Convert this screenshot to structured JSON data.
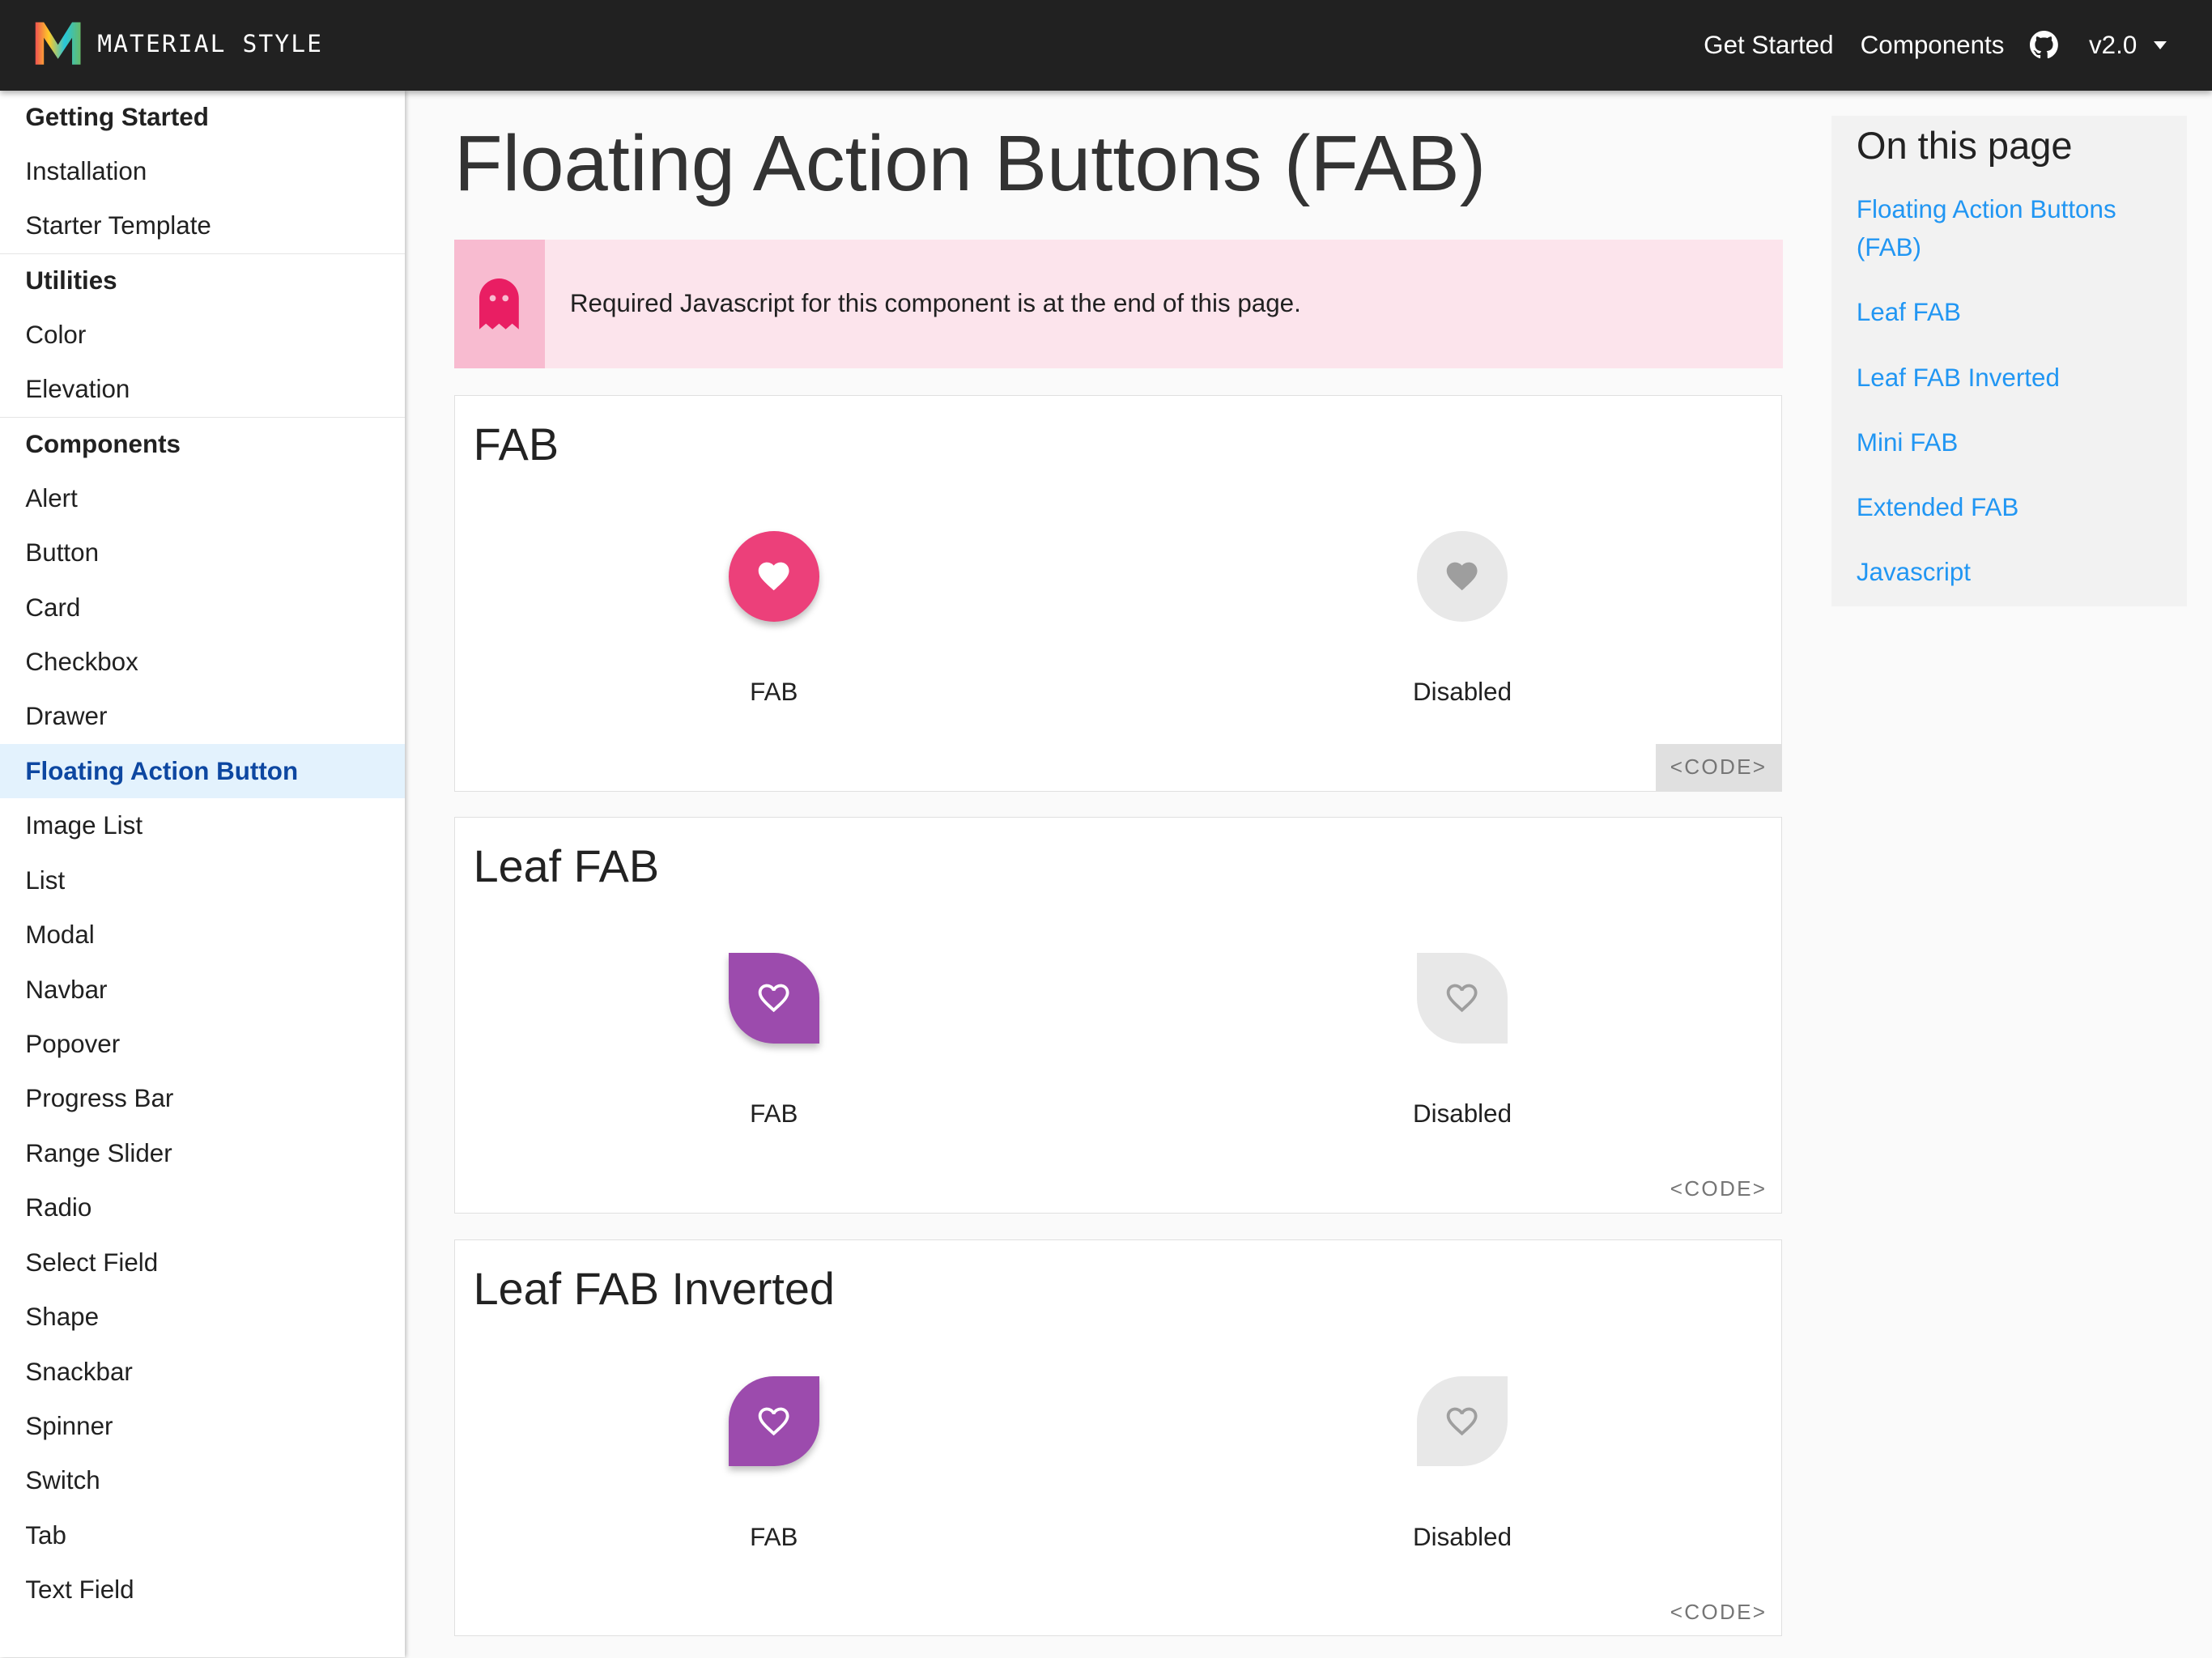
{
  "brand": {
    "name": "MATERIAL STYLE",
    "logo": "material-m-logo"
  },
  "nav": {
    "items": [
      "Get Started",
      "Components"
    ],
    "github_icon": "github-icon",
    "version": "v2.0"
  },
  "sidebar": {
    "sections": [
      {
        "title": "Getting Started",
        "items": [
          "Installation",
          "Starter Template"
        ]
      },
      {
        "title": "Utilities",
        "items": [
          "Color",
          "Elevation"
        ]
      },
      {
        "title": "Components",
        "items": [
          "Alert",
          "Button",
          "Card",
          "Checkbox",
          "Drawer",
          "Floating Action Button",
          "Image List",
          "List",
          "Modal",
          "Navbar",
          "Popover",
          "Progress Bar",
          "Range Slider",
          "Radio",
          "Select Field",
          "Shape",
          "Snackbar",
          "Spinner",
          "Switch",
          "Tab",
          "Text Field"
        ]
      }
    ],
    "active": "Floating Action Button"
  },
  "page": {
    "title": "Floating Action Buttons (FAB)",
    "alert": {
      "icon": "ghost-icon",
      "text": "Required Javascript for this component is at the end of this page."
    }
  },
  "cards": [
    {
      "title": "FAB",
      "demos": [
        {
          "label": "FAB",
          "shape": "round",
          "state": "enabled"
        },
        {
          "label": "Disabled",
          "shape": "round",
          "state": "disabled"
        }
      ],
      "code_label": "<CODE>"
    },
    {
      "title": "Leaf FAB",
      "demos": [
        {
          "label": "FAB",
          "shape": "leaf",
          "state": "enabled"
        },
        {
          "label": "Disabled",
          "shape": "leaf",
          "state": "disabled"
        }
      ],
      "code_label": "<CODE>"
    },
    {
      "title": "Leaf FAB Inverted",
      "demos": [
        {
          "label": "FAB",
          "shape": "leaf-inverted",
          "state": "enabled"
        },
        {
          "label": "Disabled",
          "shape": "leaf-inverted",
          "state": "disabled"
        }
      ],
      "code_label": "<CODE>"
    }
  ],
  "toc": {
    "title": "On this page",
    "links": [
      "Floating Action Buttons (FAB)",
      "Leaf FAB",
      "Leaf FAB Inverted",
      "Mini FAB",
      "Extended FAB",
      "Javascript"
    ]
  },
  "colors": {
    "pink": "#ec407a",
    "purple": "#9c4bad",
    "disabled_bg": "#e8e8e8",
    "disabled_icon": "#9e9e9e",
    "link": "#2196f3",
    "topbar": "#212121"
  }
}
